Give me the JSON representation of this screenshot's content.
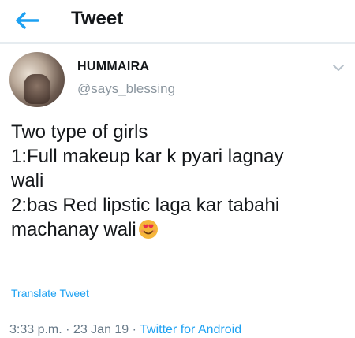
{
  "header": {
    "title": "Tweet",
    "back_icon": "back-arrow-icon"
  },
  "author": {
    "display_name": "HUMMAIRA",
    "handle": "@says_blessing"
  },
  "tweet": {
    "lines": [
      "Two type of girls",
      "1:Full makeup kar k pyari lagnay",
      "wali",
      "2:bas Red lipstic laga kar tabahi",
      "machanay wali"
    ],
    "emoji": "heart-eyes-emoji"
  },
  "translate_label": "Translate Tweet",
  "meta": {
    "time": "3:33 p.m.",
    "sep1": " · ",
    "date": "23 Jan 19",
    "sep2": " · ",
    "source": "Twitter for Android"
  },
  "colors": {
    "accent": "#1da1f2",
    "muted": "#8a959e",
    "text": "#14171a"
  }
}
